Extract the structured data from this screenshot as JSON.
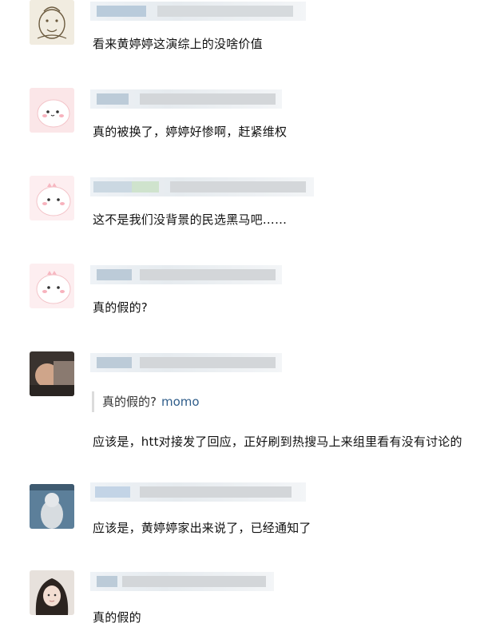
{
  "comments": [
    {
      "text": "看来黄婷婷这演综上的没啥价值"
    },
    {
      "text": "真的被换了，婷婷好惨啊，赶紧维权"
    },
    {
      "text": "这不是我们没背景的民选黑马吧……"
    },
    {
      "text": "真的假的?"
    },
    {
      "quote": {
        "text": "真的假的?",
        "name": "momo"
      },
      "text": "应该是，htt对接发了回应，正好刷到热搜马上来组里看有没有讨论的"
    },
    {
      "text": "应该是，黄婷婷家出来说了，已经通知了"
    },
    {
      "text": "真的假的"
    }
  ],
  "colors": {
    "quote_name": "#2f5d8a",
    "meta_blur": "#c5d3df"
  }
}
